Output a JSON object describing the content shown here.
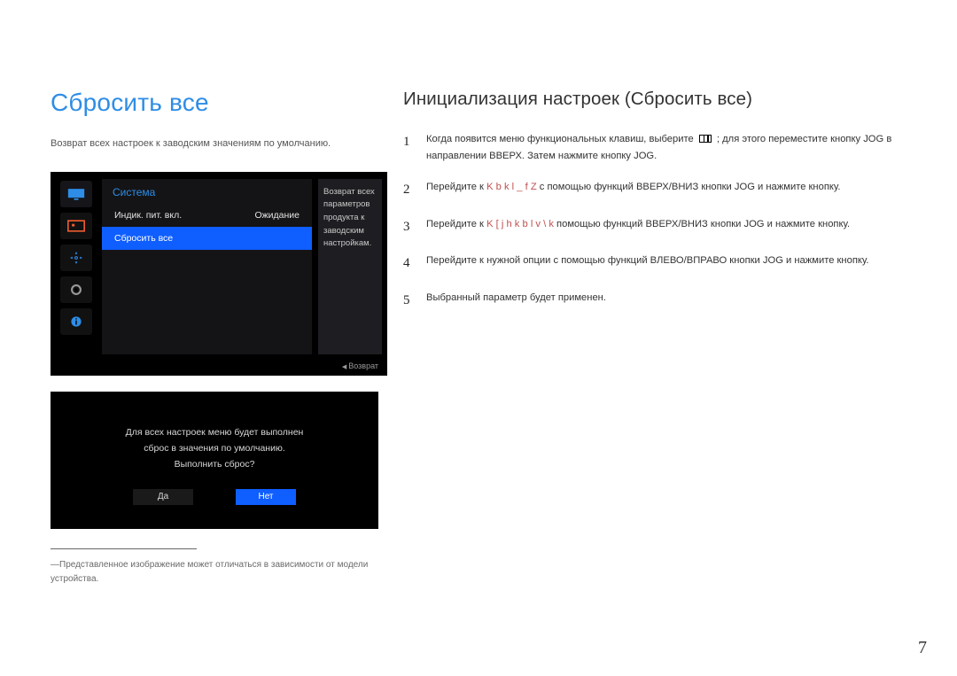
{
  "left": {
    "title": "Сбросить все",
    "subtitle": "Возврат всех настроек к заводским значениям по умолчанию.",
    "osd": {
      "menu_title": "Система",
      "row1_label": "Индик. пит. вкл.",
      "row1_value": "Ожидание",
      "row2_label": "Сбросить все",
      "right_box": "Возврат всех параметров продукта к заводским настройкам.",
      "footer": "Возврат"
    },
    "dialog": {
      "line1": "Для всех настроек меню будет выполнен",
      "line2": "сброс в значения по умолчанию.",
      "line3": "Выполнить сброс?",
      "yes": "Да",
      "no": "Нет"
    },
    "footnote": "Представленное изображение может отличаться в зависимости от модели устройства."
  },
  "right": {
    "title": "Инициализация настроек (Сбросить все)",
    "steps": {
      "s1a": "Когда появится меню функциональных клавиш, выберите ",
      "s1b": " ; для этого переместите кнопку JOG в направлении ВВЕРХ. Затем нажмите кнопку JOG.",
      "s2a": "Перейдите к ",
      "s2hl": "K b k l _ f Z",
      "s2b": " с помощью функций ВВЕРХ/ВНИЗ кнопки JOG и нажмите кнопку.",
      "s3a": "Перейдите к ",
      "s3hl": "K [ j h k b l v  \\ k",
      "s3b": " помощью функций ВВЕРХ/ВНИЗ кнопки JOG и нажмите кнопку.",
      "s4": "Перейдите к нужной опции с помощью функций ВЛЕВО/ВПРАВО кнопки JOG и нажмите кнопку.",
      "s5": "Выбранный параметр будет применен."
    }
  },
  "page_number": "7"
}
